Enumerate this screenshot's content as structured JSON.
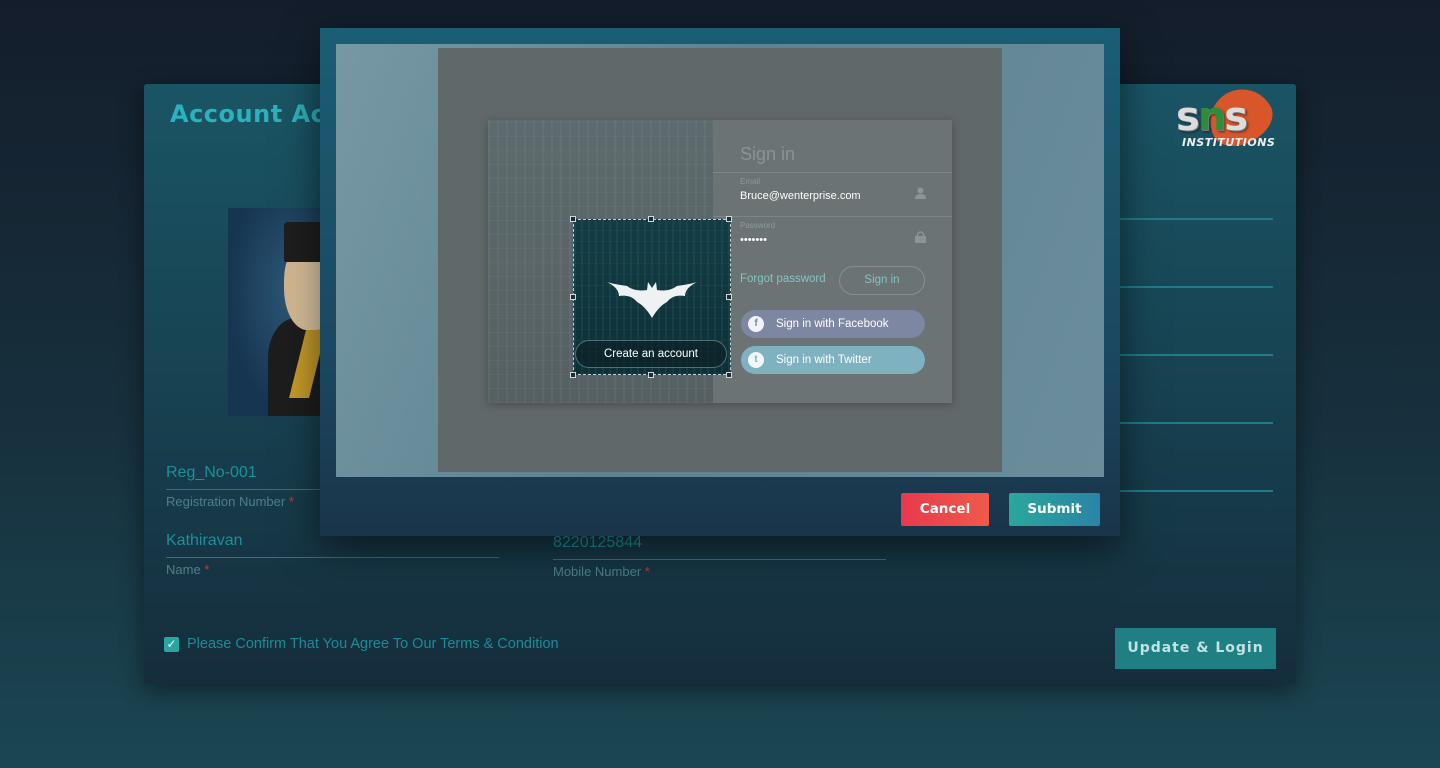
{
  "card": {
    "title": "Account Activation",
    "logo": {
      "text_left": "s",
      "text_mid": "n",
      "text_right": "s",
      "subtitle": "INSTITUTIONS"
    },
    "fields": {
      "reg_value": "Reg_No-001",
      "reg_label": "Registration Number",
      "name_value": "Kathiravan",
      "name_label": "Name",
      "mobile_value": "8220125844",
      "mobile_label": "Mobile Number",
      "required_mark": "*"
    },
    "terms": {
      "checked": true,
      "check_glyph": "✓",
      "text": "Please Confirm That You Agree To Our Terms & Condition"
    },
    "update_button": "Update & Login"
  },
  "modal": {
    "cropper": {
      "create_account": "Create an account",
      "signin_title": "Sign in",
      "email_caption": "Email",
      "email_value": "Bruce@wenterprise.com",
      "password_caption": "Password",
      "password_value": "•••••••",
      "forgot": "Forgot password",
      "signin_button": "Sign in",
      "facebook": "Sign in with Facebook",
      "facebook_icon": "f",
      "twitter": "Sign in with Twitter",
      "twitter_icon": "t"
    },
    "cancel": "Cancel",
    "submit": "Submit"
  },
  "colors": {
    "accent": "#2ab3bd",
    "cancel": "#e8394d",
    "submit": "#2a95a2",
    "update": "#207f82"
  }
}
